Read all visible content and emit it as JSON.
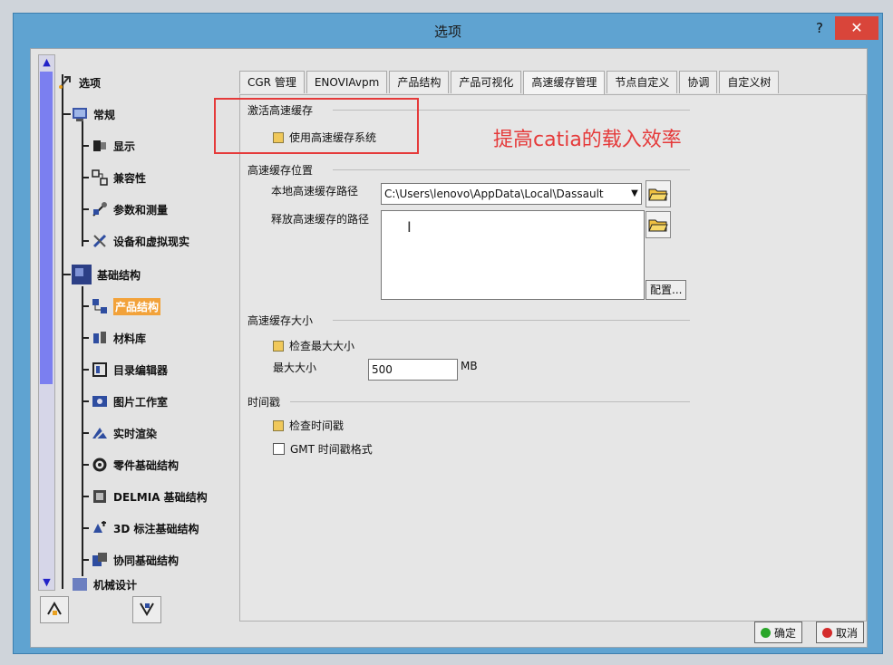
{
  "window": {
    "title": "选项",
    "help_label": "?",
    "close_label": "✕"
  },
  "tree": {
    "items": [
      {
        "label": "选项",
        "icon": "options-tree-icon"
      },
      {
        "label": "常规",
        "icon": "general-icon"
      },
      {
        "label": "显示",
        "icon": "display-icon"
      },
      {
        "label": "兼容性",
        "icon": "compatibility-icon"
      },
      {
        "label": "参数和测量",
        "icon": "parameters-icon"
      },
      {
        "label": "设备和虚拟现实",
        "icon": "devices-icon"
      },
      {
        "label": "基础结构",
        "icon": "infrastructure-icon"
      },
      {
        "label": "产品结构",
        "icon": "product-structure-icon"
      },
      {
        "label": "材料库",
        "icon": "material-library-icon"
      },
      {
        "label": "目录编辑器",
        "icon": "catalog-editor-icon"
      },
      {
        "label": "图片工作室",
        "icon": "photo-studio-icon"
      },
      {
        "label": "实时渲染",
        "icon": "realtime-render-icon"
      },
      {
        "label": "零件基础结构",
        "icon": "part-infrastructure-icon"
      },
      {
        "label": "DELMIA 基础结构",
        "icon": "delmia-icon"
      },
      {
        "label": "3D 标注基础结构",
        "icon": "annotation-icon"
      },
      {
        "label": "协同基础结构",
        "icon": "collaboration-icon"
      },
      {
        "label": "机械设计",
        "icon": "mechanical-design-icon"
      }
    ],
    "selected_index": 7
  },
  "tabs": [
    {
      "label": "CGR 管理"
    },
    {
      "label": "ENOVIAvpm"
    },
    {
      "label": "产品结构"
    },
    {
      "label": "产品可视化"
    },
    {
      "label": "高速缓存管理"
    },
    {
      "label": "节点自定义"
    },
    {
      "label": "协调"
    },
    {
      "label": "自定义树"
    }
  ],
  "active_tab_index": 4,
  "cache": {
    "activate_title": "激活高速缓存",
    "use_cache_label": "使用高速缓存系统",
    "location_title": "高速缓存位置",
    "local_path_label": "本地高速缓存路径",
    "local_path_value": "C:\\Users\\lenovo\\AppData\\Local\\Dassault",
    "release_path_label": "释放高速缓存的路径",
    "config_label": "配置...",
    "size_title": "高速缓存大小",
    "check_max_label": "检查最大大小",
    "max_size_label": "最大大小",
    "max_size_value": "500",
    "max_size_unit": "MB",
    "timestamp_title": "时间戳",
    "check_timestamp_label": "检查时间戳",
    "gmt_label": "GMT 时间戳格式"
  },
  "buttons": {
    "ok_label": "确定",
    "cancel_label": "取消"
  },
  "annotation": {
    "text": "提高catia的载入效率"
  },
  "colors": {
    "title_bar": "#5fa3d1",
    "selected_item": "#f2a23a",
    "annotation_red": "#e53a3a",
    "ok_dot": "#2aa62a",
    "cancel_dot": "#d42b2b"
  }
}
